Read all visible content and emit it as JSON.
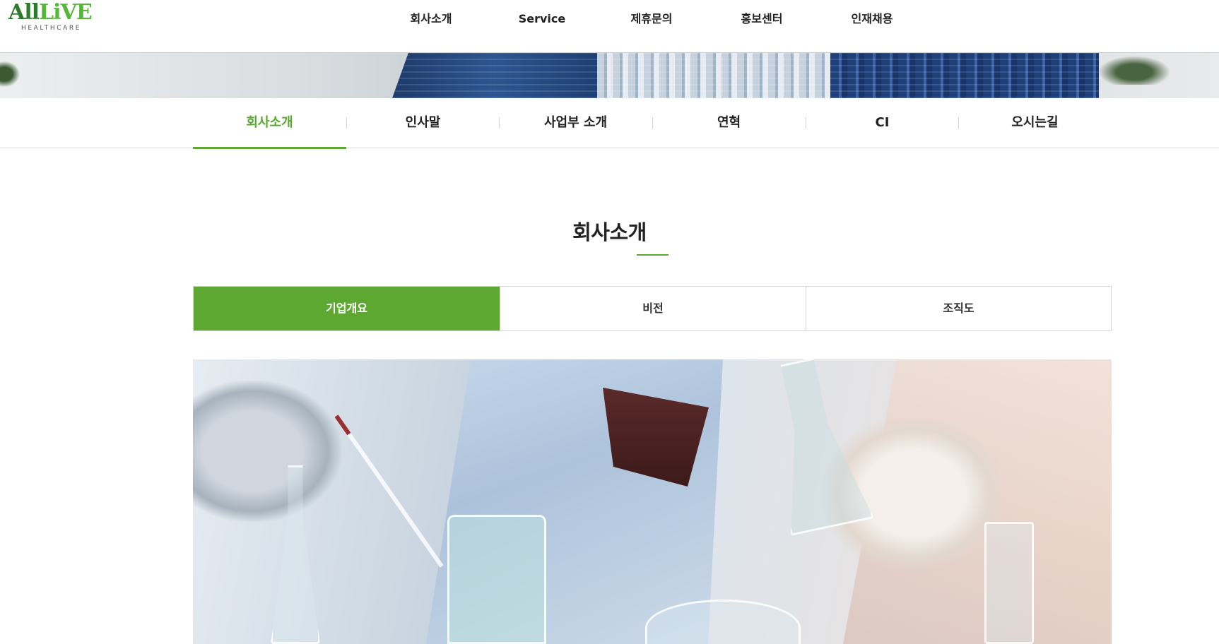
{
  "brand": {
    "logo_word_1": "All",
    "logo_word_2": "LiVE",
    "logo_sub": "HEALTHCARE",
    "accent_color": "#5ea831"
  },
  "gnb": {
    "items": [
      {
        "label": "회사소개"
      },
      {
        "label": "Service"
      },
      {
        "label": "제휴문의"
      },
      {
        "label": "홍보센터"
      },
      {
        "label": "인재채용"
      }
    ]
  },
  "lnb": {
    "active_index": 0,
    "items": [
      {
        "label": "회사소개"
      },
      {
        "label": "인사말"
      },
      {
        "label": "사업부 소개"
      },
      {
        "label": "연혁"
      },
      {
        "label": "CI"
      },
      {
        "label": "오시는길"
      }
    ]
  },
  "page": {
    "title": "회사소개"
  },
  "tabs": {
    "active_index": 0,
    "items": [
      {
        "label": "기업개요"
      },
      {
        "label": "비전"
      },
      {
        "label": "조직도"
      }
    ]
  }
}
